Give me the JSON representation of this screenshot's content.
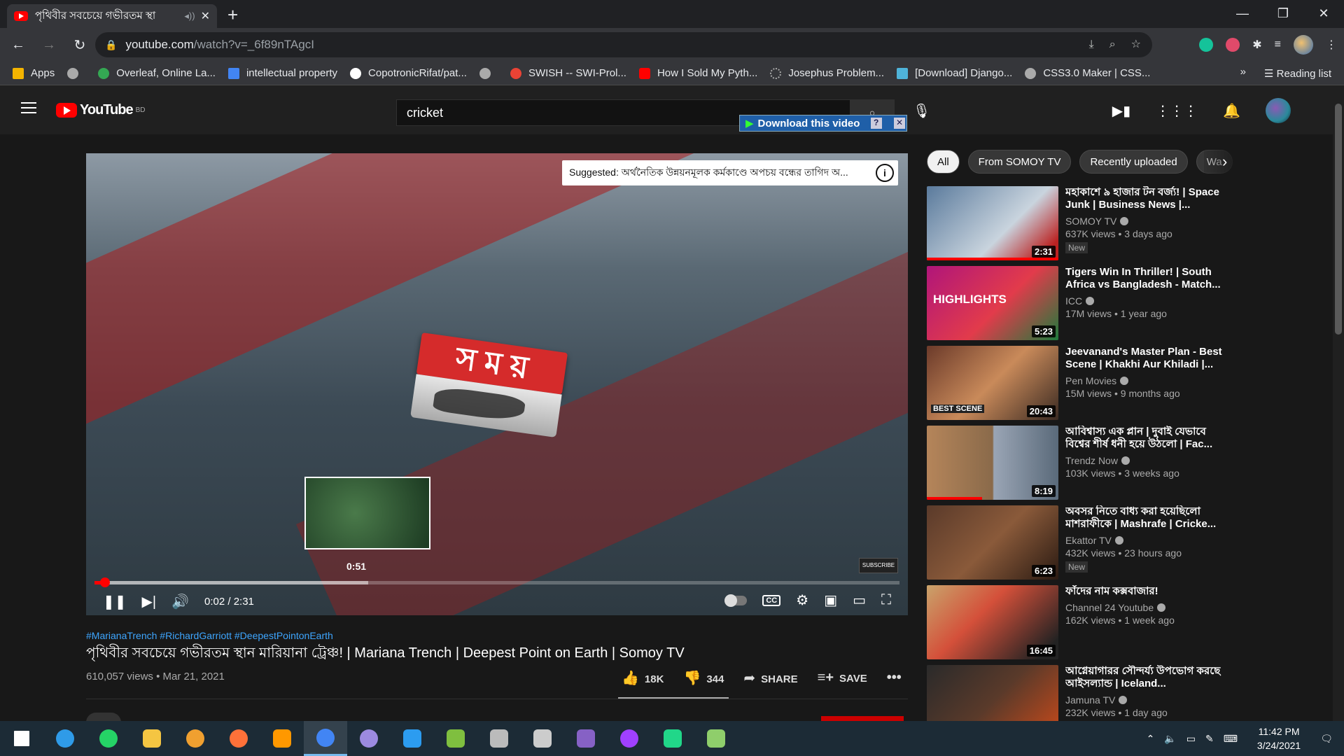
{
  "browser": {
    "tab_title": "পৃথিবীর সবচেয়ে গভীরতম স্থা",
    "url_host": "youtube.com",
    "url_path": "/watch?v=_6f89nTAgcI",
    "bookmarks": [
      "Apps",
      "Overleaf, Online La...",
      "intellectual property",
      "CopotronicRifat/pat...",
      "SWISH -- SWI-Prol...",
      "How I Sold My Pyth...",
      "Josephus Problem...",
      "[Download] Django...",
      "CSS3.0 Maker | CSS..."
    ],
    "bookmark_colors": [
      "#f4b400",
      "#aaaaaa",
      "#34a853",
      "#4285f4",
      "#ffffff",
      "#aaaaaa",
      "#ea4335",
      "#ff0000",
      "#aaaaaa",
      "#4fb3d9",
      "#aaaaaa"
    ],
    "reading_list": "Reading list",
    "more": "»"
  },
  "youtube": {
    "logo_word": "YouTube",
    "region": "BD",
    "search_value": "cricket",
    "download_label": "Download this video"
  },
  "player": {
    "suggested": "Suggested: অর্থনৈতিক উন্নয়নমূলক কর্মকাণ্ডে অপচয় বন্ধের তাগিদ অ...",
    "logo_text": "স ম য়",
    "preview_time": "0:51",
    "time": "0:02 / 2:31",
    "played_fraction": 0.013,
    "subscribe_wm": "SUBSCRIBE"
  },
  "video": {
    "hashtags": "#MarianaTrench #RichardGarriott #DeepestPointonEarth",
    "title": "পৃথিবীর সবচেয়ে গভীরতম স্থান মারিয়ানা ট্রেঞ্চ! | Mariana Trench | Deepest Point on Earth | Somoy TV",
    "meta": "610,057 views • Mar 21, 2021",
    "likes": "18K",
    "dislikes": "344",
    "share": "SHARE",
    "save": "SAVE"
  },
  "chips": [
    "All",
    "From SOMOY TV",
    "Recently uploaded",
    "Wa"
  ],
  "recs": [
    {
      "title": "মহাকাশে ৯ হাজার টন বর্জ্য! | Space Junk | Business News |...",
      "channel": "SOMOY TV",
      "meta": "637K views • 3 days ago",
      "duration": "2:31",
      "badge": "New",
      "bg": "linear-gradient(135deg,#5a7a9c,#c9d4de 60%,#b22 90%)",
      "watched": 1.0
    },
    {
      "title": "Tigers Win In Thriller! | South Africa vs Bangladesh - Match...",
      "channel": "ICC",
      "meta": "17M views • 1 year ago",
      "duration": "5:23",
      "badge": "",
      "bg": "linear-gradient(135deg,#b0157a,#e23b4b 55%,#1e7a3c)",
      "watched": 0,
      "overlay": "HIGHLIGHTS"
    },
    {
      "title": "Jeevanand's Master Plan - Best Scene | Khakhi Aur Khiladi |...",
      "channel": "Pen Movies",
      "meta": "15M views • 9 months ago",
      "duration": "20:43",
      "badge": "",
      "bg": "linear-gradient(135deg,#6b3a2a,#c98a5a 50%,#3a2a22)",
      "watched": 0,
      "overlay": "BEST SCENE"
    },
    {
      "title": "আবিশ্বাস্য এক প্লান | দুবাই যেভাবে বিশ্বের শীর্ষ ধনী হয়ে উঠলো | Fac...",
      "channel": "Trendz Now",
      "meta": "103K views • 3 weeks ago",
      "duration": "8:19",
      "badge": "",
      "bg": "linear-gradient(90deg,#b5855a,#8a6a4a 50%,#9aa5b5 51%,#5a6a7a)",
      "watched": 0.42
    },
    {
      "title": "অবসর নিতে বাধ্য করা হয়েছিলো মাশরাফীকে | Mashrafe | Cricke...",
      "channel": "Ekattor TV",
      "meta": "432K views • 23 hours ago",
      "duration": "6:23",
      "badge": "New",
      "bg": "linear-gradient(135deg,#5a3a2a,#8a5a3a 50%,#2a1a12)",
      "watched": 0
    },
    {
      "title": "ফাঁদের নাম কক্সবাজার!",
      "channel": "Channel 24 Youtube",
      "meta": "162K views • 1 week ago",
      "duration": "16:45",
      "badge": "",
      "bg": "linear-gradient(135deg,#c9a36b,#d4503a 40%,#222 90%)",
      "watched": 0
    },
    {
      "title": "আগ্নেয়াগারর সৌন্দর্য্য উপভোগ করছে আইসল্যান্ড | Iceland...",
      "channel": "Jamuna TV",
      "meta": "232K views • 1 day ago",
      "duration": "",
      "badge": "",
      "bg": "linear-gradient(135deg,#2a2a2a,#5a3a2a 50%,#c94a1a)",
      "watched": 0
    }
  ],
  "taskbar": {
    "icons": [
      {
        "name": "start-icon",
        "color": "#ffffff"
      },
      {
        "name": "search-icon",
        "color": "#2f9be8"
      },
      {
        "name": "whatsapp-icon",
        "color": "#25d366"
      },
      {
        "name": "file-explorer-icon",
        "color": "#f4c542"
      },
      {
        "name": "brave-icon",
        "color": "#f0a030"
      },
      {
        "name": "firefox-icon",
        "color": "#ff7139"
      },
      {
        "name": "sublime-icon",
        "color": "#ff9800"
      },
      {
        "name": "chrome-icon",
        "color": "#4285f4"
      },
      {
        "name": "github-icon",
        "color": "#9c8ae0"
      },
      {
        "name": "vscode-icon",
        "color": "#2c9cf0"
      },
      {
        "name": "app-icon",
        "color": "#7fbf3f"
      },
      {
        "name": "app-icon-2",
        "color": "#bbbbbb"
      },
      {
        "name": "app-icon-3",
        "color": "#cccccc"
      },
      {
        "name": "visual-studio-icon",
        "color": "#8661c5"
      },
      {
        "name": "messenger-icon",
        "color": "#a040ff"
      },
      {
        "name": "pycharm-icon",
        "color": "#21d789"
      },
      {
        "name": "notepad-icon",
        "color": "#8fce6b"
      }
    ],
    "time": "11:42 PM",
    "date": "3/24/2021"
  }
}
